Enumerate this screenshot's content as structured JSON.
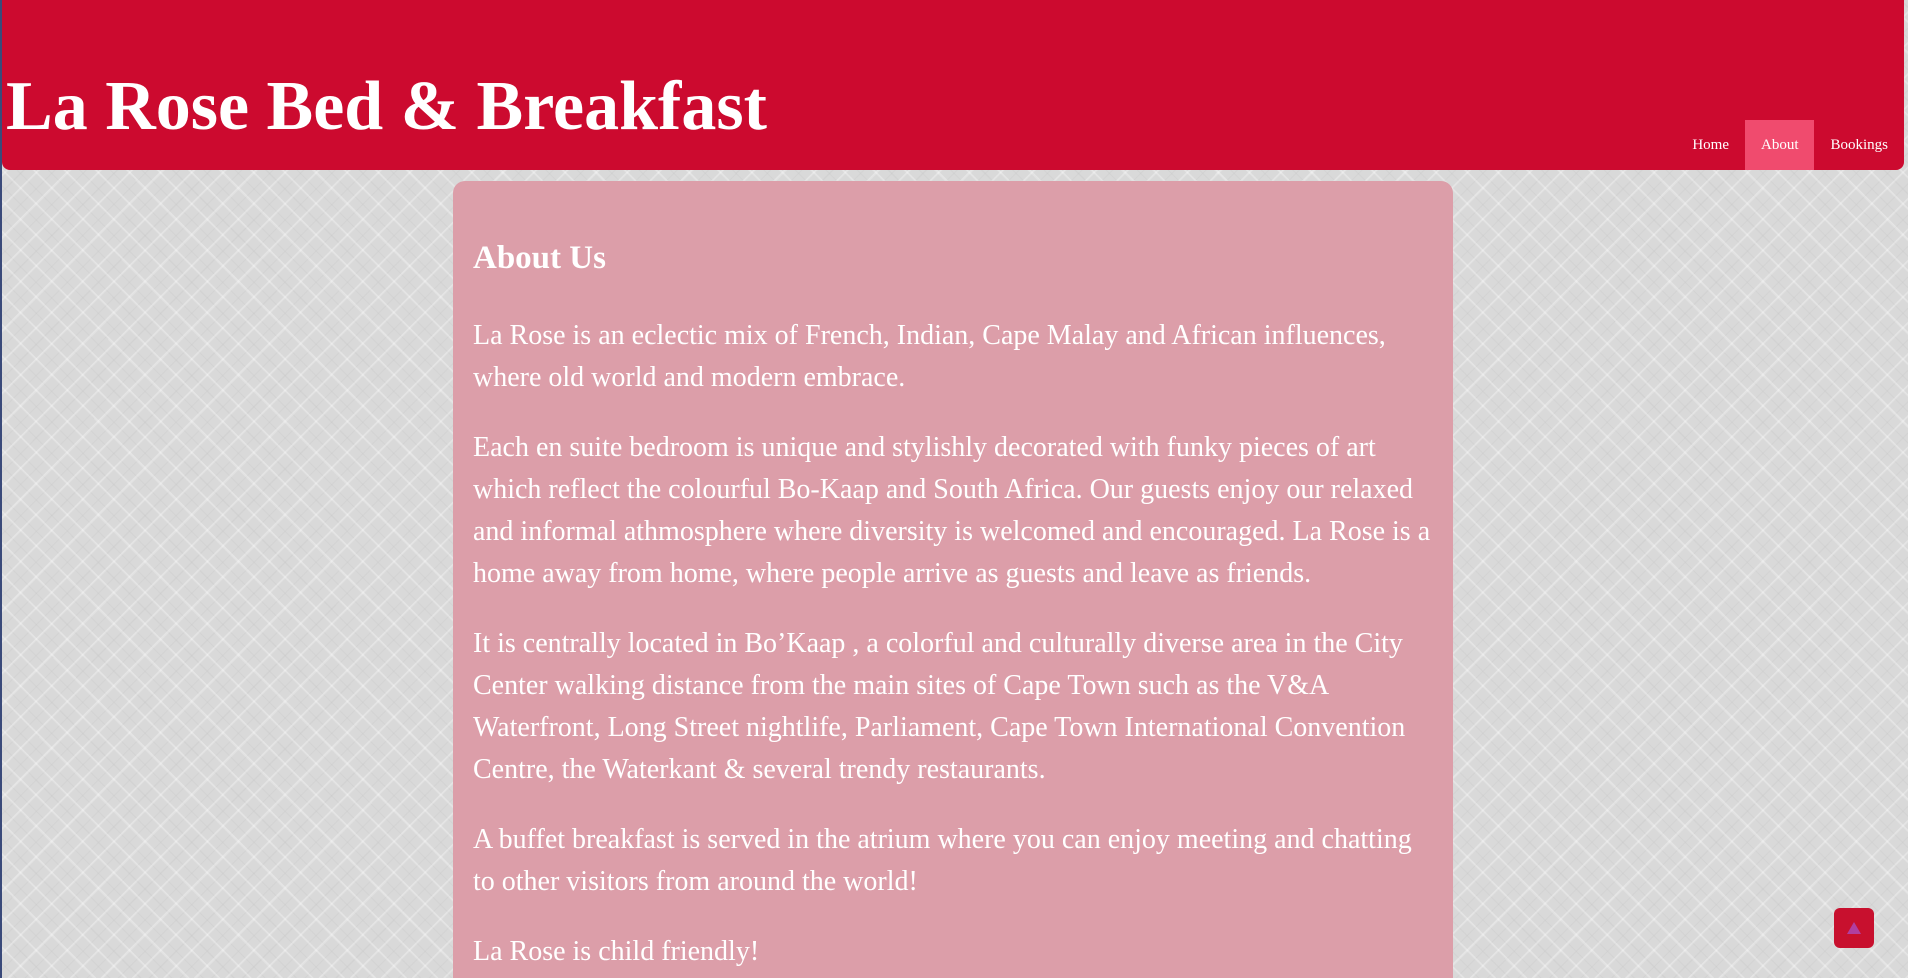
{
  "header": {
    "title": "La Rose Bed & Breakfast",
    "background_color": "#cc0a2f"
  },
  "nav": {
    "items": [
      {
        "label": "Home",
        "active": false
      },
      {
        "label": "About",
        "active": true
      },
      {
        "label": "Bookings",
        "active": false
      }
    ],
    "active_color": "#f04b6e"
  },
  "main": {
    "heading": "About Us",
    "paragraphs": [
      "La Rose is an eclectic mix of French, Indian, Cape Malay and African influences, where old world and modern embrace.",
      "Each en suite bedroom is unique and stylishly decorated with funky pieces of art which reflect the colourful Bo-Kaap and South Africa. Our guests enjoy our relaxed and informal athmosphere where diversity is welcomed and encouraged. La Rose is a home away from home, where people arrive as guests and leave as friends.",
      "It is centrally located in Bo’Kaap , a colorful and culturally diverse area in the City Center walking distance from the main sites of Cape Town such as the V&A Waterfront, Long Street nightlife, Parliament, Cape Town International Convention Centre, the Waterkant & several trendy restaurants.",
      "A buffet breakfast is served in the atrium where you can enjoy meeting and chatting to other visitors from around the world!",
      "La Rose is child friendly!"
    ],
    "card_color": "#dc9ea9"
  },
  "back_to_top": {
    "icon": "arrow-up-icon",
    "background_color": "#c8102e",
    "icon_color": "#b03fa0"
  }
}
